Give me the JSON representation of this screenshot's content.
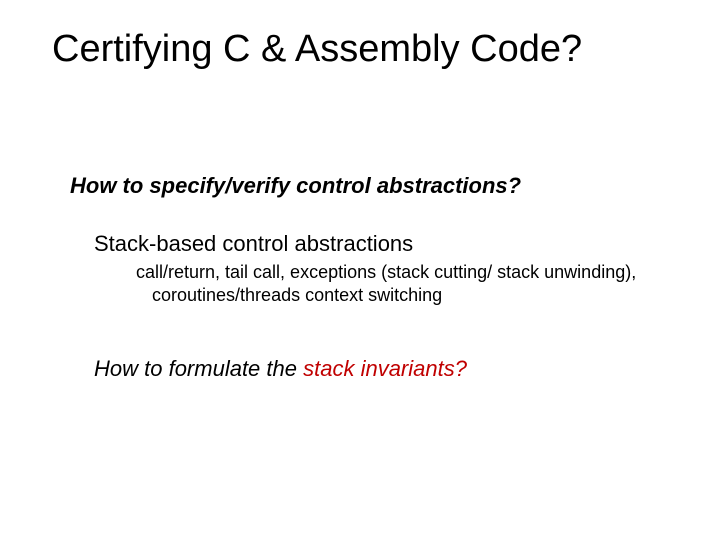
{
  "title": "Certifying C & Assembly Code?",
  "subtitle": "How to specify/verify control abstractions?",
  "point": "Stack-based control abstractions",
  "detail": "call/return, tail call, exceptions (stack cutting/ stack unwinding), coroutines/threads context switching",
  "question_prefix": "How to formulate the ",
  "question_highlight": "stack invariants",
  "question_suffix": "?"
}
